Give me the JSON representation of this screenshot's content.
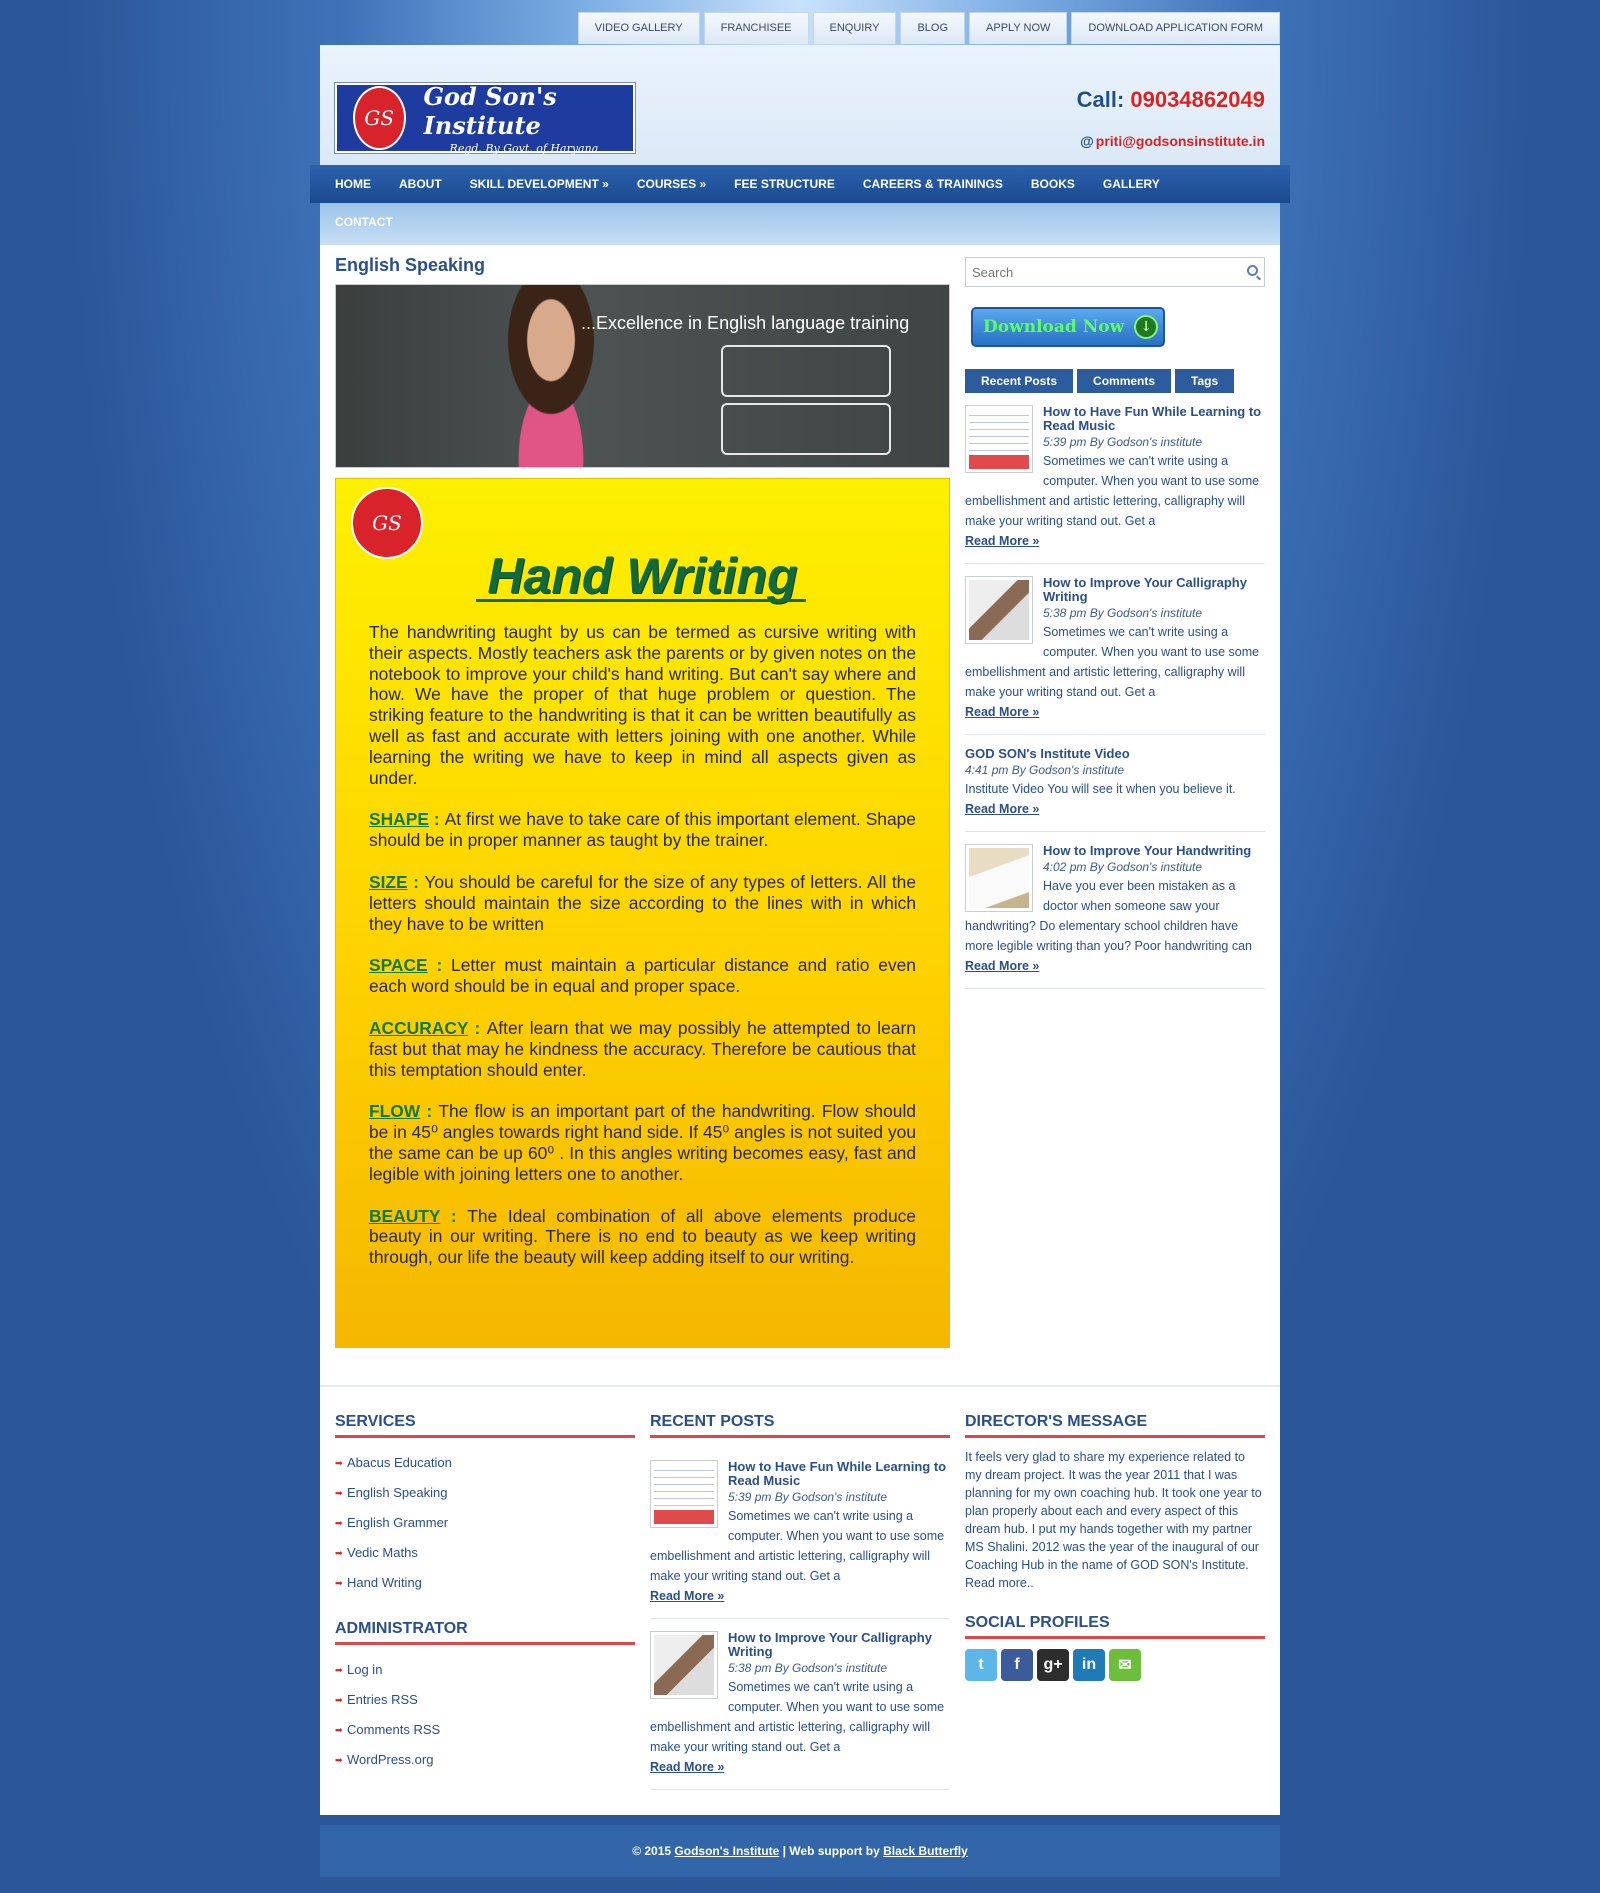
{
  "topnav": [
    "VIDEO GALLERY",
    "FRANCHISEE",
    "ENQUIRY",
    "BLOG",
    "APPLY NOW",
    "DOWNLOAD APPLICATION FORM"
  ],
  "header": {
    "logo_title": "God Son's Institute",
    "logo_subtitle": "Regd. By Govt. of Haryana",
    "call_label": "Call:",
    "call_number": "09034862049",
    "email": "priti@godsonsinstitute.in"
  },
  "mainnav": [
    "HOME",
    "ABOUT",
    "SKILL DEVELOPMENT »",
    "COURSES »",
    "FEE STRUCTURE",
    "CAREERS & TRAININGS",
    "BOOKS",
    "GALLERY"
  ],
  "mainnav_row2": "CONTACT",
  "page": {
    "title": "English Speaking",
    "banner_text": "...Excellence in English language training"
  },
  "handwriting": {
    "title": "Hand Writing",
    "intro": "The handwriting taught by us can be termed as cursive writing with their aspects. Mostly teachers ask the parents or by given notes on the notebook to improve your child's hand writing. But can't say where and how. We have the proper of that huge problem or question. The striking feature to the handwriting is that  it can be written beautifully as well as fast and accurate with letters joining with one another. While learning the writing we have to keep in mind all aspects given as under.",
    "items": [
      {
        "key": "SHAPE",
        "sep": " : ",
        "text": "At first we have to take care of this important element. Shape should be in proper manner as taught  by the trainer."
      },
      {
        "key": "SIZE",
        "sep": " : ",
        "text": "You should be careful for the size of any types of letters. All the letters should maintain the size according to the lines with in which they have to be written"
      },
      {
        "key": "SPACE",
        "sep": " : ",
        "text": "Letter must maintain a particular distance and ratio even each word should be in  equal and proper space."
      },
      {
        "key": "ACCURACY",
        "sep": " : ",
        "text": "After learn that we may possibly he attempted to learn fast but that may he kindness the accuracy. Therefore be cautious that this temptation should enter."
      },
      {
        "key": "FLOW",
        "sep": " : ",
        "text": "The flow is an important part of the handwriting. Flow should be in 45⁰ angles towards right hand side. If 45⁰ angles is not suited you the same can be up 60⁰ . In this angles writing becomes easy, fast and legible with joining letters one to another."
      },
      {
        "key": "BEAUTY",
        "sep": " :  ",
        "text": "The Ideal combination of all above elements produce beauty in our writing. There is no end to beauty as we keep writing through, our life the beauty will keep adding itself to our writing."
      }
    ]
  },
  "sidebar": {
    "search_placeholder": "Search",
    "download_label": "Download Now",
    "tabs": [
      "Recent Posts",
      "Comments",
      "Tags"
    ],
    "posts": [
      {
        "title": "How to Have Fun While Learning to Read Music",
        "meta": "5:39 pm By Godson's institute",
        "excerpt": "Sometimes we can't write using a computer. When you want to use some embellishment and artistic lettering, calligraphy will make your writing stand out. Get a",
        "more": "Read More »",
        "thumb": "music"
      },
      {
        "title": "How to Improve Your Calligraphy Writing",
        "meta": "5:38 pm By Godson's institute",
        "excerpt": "Sometimes we can't write using a computer. When you want to use some embellishment and artistic lettering, calligraphy will make your writing stand out. Get a",
        "more": "Read More »",
        "thumb": "pen"
      },
      {
        "title": "GOD SON's Institute Video",
        "meta": "4:41 pm By Godson's institute",
        "excerpt": "Institute Video   You will see it when you believe it.",
        "more": "Read More »",
        "thumb": ""
      },
      {
        "title": "How to Improve Your Handwriting",
        "meta": "4:02 pm By Godson's institute",
        "excerpt": "Have you ever been mistaken as a doctor when someone saw your handwriting? Do elementary school children have more legible writing than you? Poor handwriting can",
        "more": "Read More »",
        "thumb": "notebook"
      }
    ]
  },
  "footer": {
    "services_title": "SERVICES",
    "services": [
      "Abacus Education",
      "English Speaking",
      "English Grammer",
      "Vedic Maths",
      "Hand Writing"
    ],
    "admin_title": "ADMINISTRATOR",
    "admin": [
      "Log in",
      "Entries RSS",
      "Comments RSS",
      "WordPress.org"
    ],
    "recent_title": "RECENT POSTS",
    "recent": [
      {
        "title": "How to Have Fun While Learning to Read Music",
        "meta": "5:39 pm By Godson's institute",
        "excerpt": "Sometimes we can't write using a computer. When you want to use some embellishment and artistic lettering, calligraphy will make your writing stand out. Get a",
        "more": "Read More »",
        "thumb": "music"
      },
      {
        "title": "How to Improve Your Calligraphy Writing",
        "meta": "5:38 pm By Godson's institute",
        "excerpt": "Sometimes we can't write using a computer. When you want to use some embellishment and artistic lettering, calligraphy will make your writing stand out. Get a",
        "more": "Read More »",
        "thumb": "pen"
      }
    ],
    "director_title": "DIRECTOR'S MESSAGE",
    "director_text": "It feels very glad to share my experience related to my dream project. It was the year 2011 that I was planning for my own coaching hub. It took one year to plan properly about each and every aspect of this dream hub. I put my hands together with my partner MS Shalini. 2012 was the year of the inaugural of our Coaching Hub in the name of GOD SON's Institute. Read more..",
    "social_title": "SOCIAL PROFILES",
    "social": [
      {
        "name": "twitter-icon",
        "glyph": "t",
        "color": "#5db6e8"
      },
      {
        "name": "facebook-icon",
        "glyph": "f",
        "color": "#3b5b9a"
      },
      {
        "name": "google-plus-icon",
        "glyph": "g+",
        "color": "#2d2d2d"
      },
      {
        "name": "linkedin-icon",
        "glyph": "in",
        "color": "#1f7ab8"
      },
      {
        "name": "email-icon",
        "glyph": "✉",
        "color": "#6cbe3b"
      }
    ]
  },
  "bottom": {
    "copyright": "© 2015 ",
    "site": "Godson's Institute",
    "support": " | Web support by ",
    "vendor": "Black Butterfly"
  }
}
